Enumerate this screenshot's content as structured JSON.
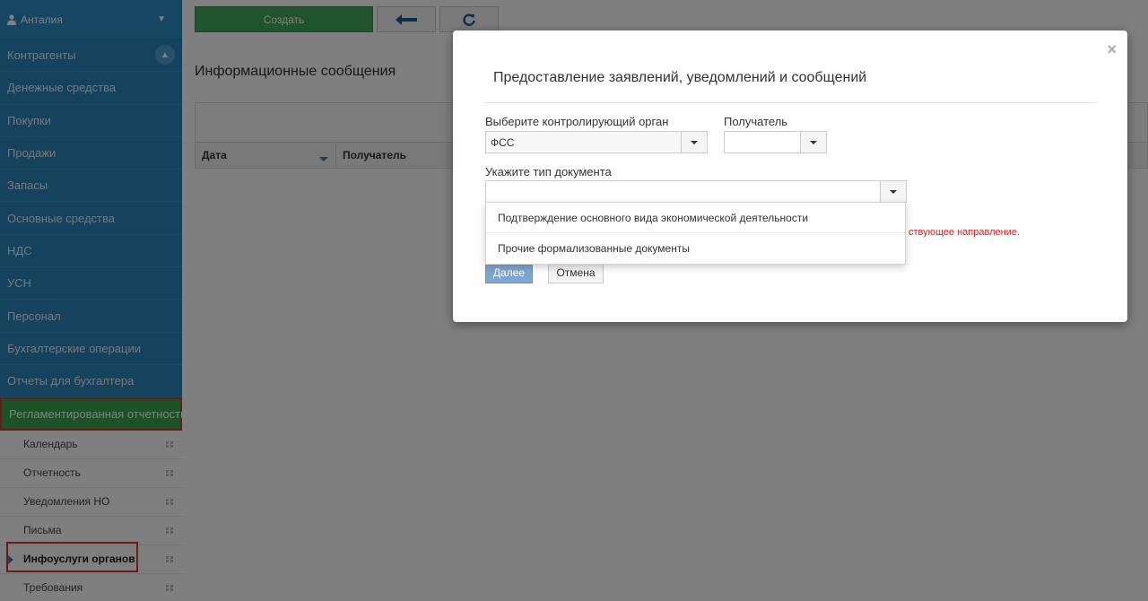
{
  "sidebar": {
    "user": "Анталия",
    "items": [
      {
        "label": "Контрагенты"
      },
      {
        "label": "Денежные средства"
      },
      {
        "label": "Покупки"
      },
      {
        "label": "Продажи"
      },
      {
        "label": "Запасы"
      },
      {
        "label": "Основные средства"
      },
      {
        "label": "НДС"
      },
      {
        "label": "УСН"
      },
      {
        "label": "Персонал"
      },
      {
        "label": "Бухгалтерские операции"
      },
      {
        "label": "Отчеты для бухгалтера"
      },
      {
        "label": "Регламентированная отчетность"
      }
    ],
    "sub_items": [
      {
        "label": "Календарь"
      },
      {
        "label": "Отчетность"
      },
      {
        "label": "Уведомления НО"
      },
      {
        "label": "Письма"
      },
      {
        "label": "Инфоуслуги органов"
      },
      {
        "label": "Требования"
      }
    ]
  },
  "toolbar": {
    "create_label": "Создать",
    "back_icon": "arrow-left-icon",
    "refresh_icon": "refresh-icon"
  },
  "main": {
    "title": "Информационные сообщения",
    "columns": [
      "Дата",
      "Получатель"
    ]
  },
  "modal": {
    "title": "Предоставление заявлений, уведомлений и сообщений",
    "org_label": "Выберите контролирующий орган",
    "org_value": "ФСС",
    "recipient_label": "Получатель",
    "recipient_value": "",
    "doc_type_label": "Укажите тип документа",
    "doc_type_value": "",
    "doc_type_options": [
      "Подтверждение основного вида экономической деятельности",
      "Прочие формализованные документы"
    ],
    "note": "ствующее направление.",
    "next_label": "Далее",
    "cancel_label": "Отмена",
    "close_glyph": "×"
  },
  "colors": {
    "sidebar_bg": "#2a85b8",
    "active_item": "#3aa24f",
    "create_button": "#3fa85a",
    "highlight_border": "#d23b2f",
    "note_text": "#d21f1f"
  }
}
